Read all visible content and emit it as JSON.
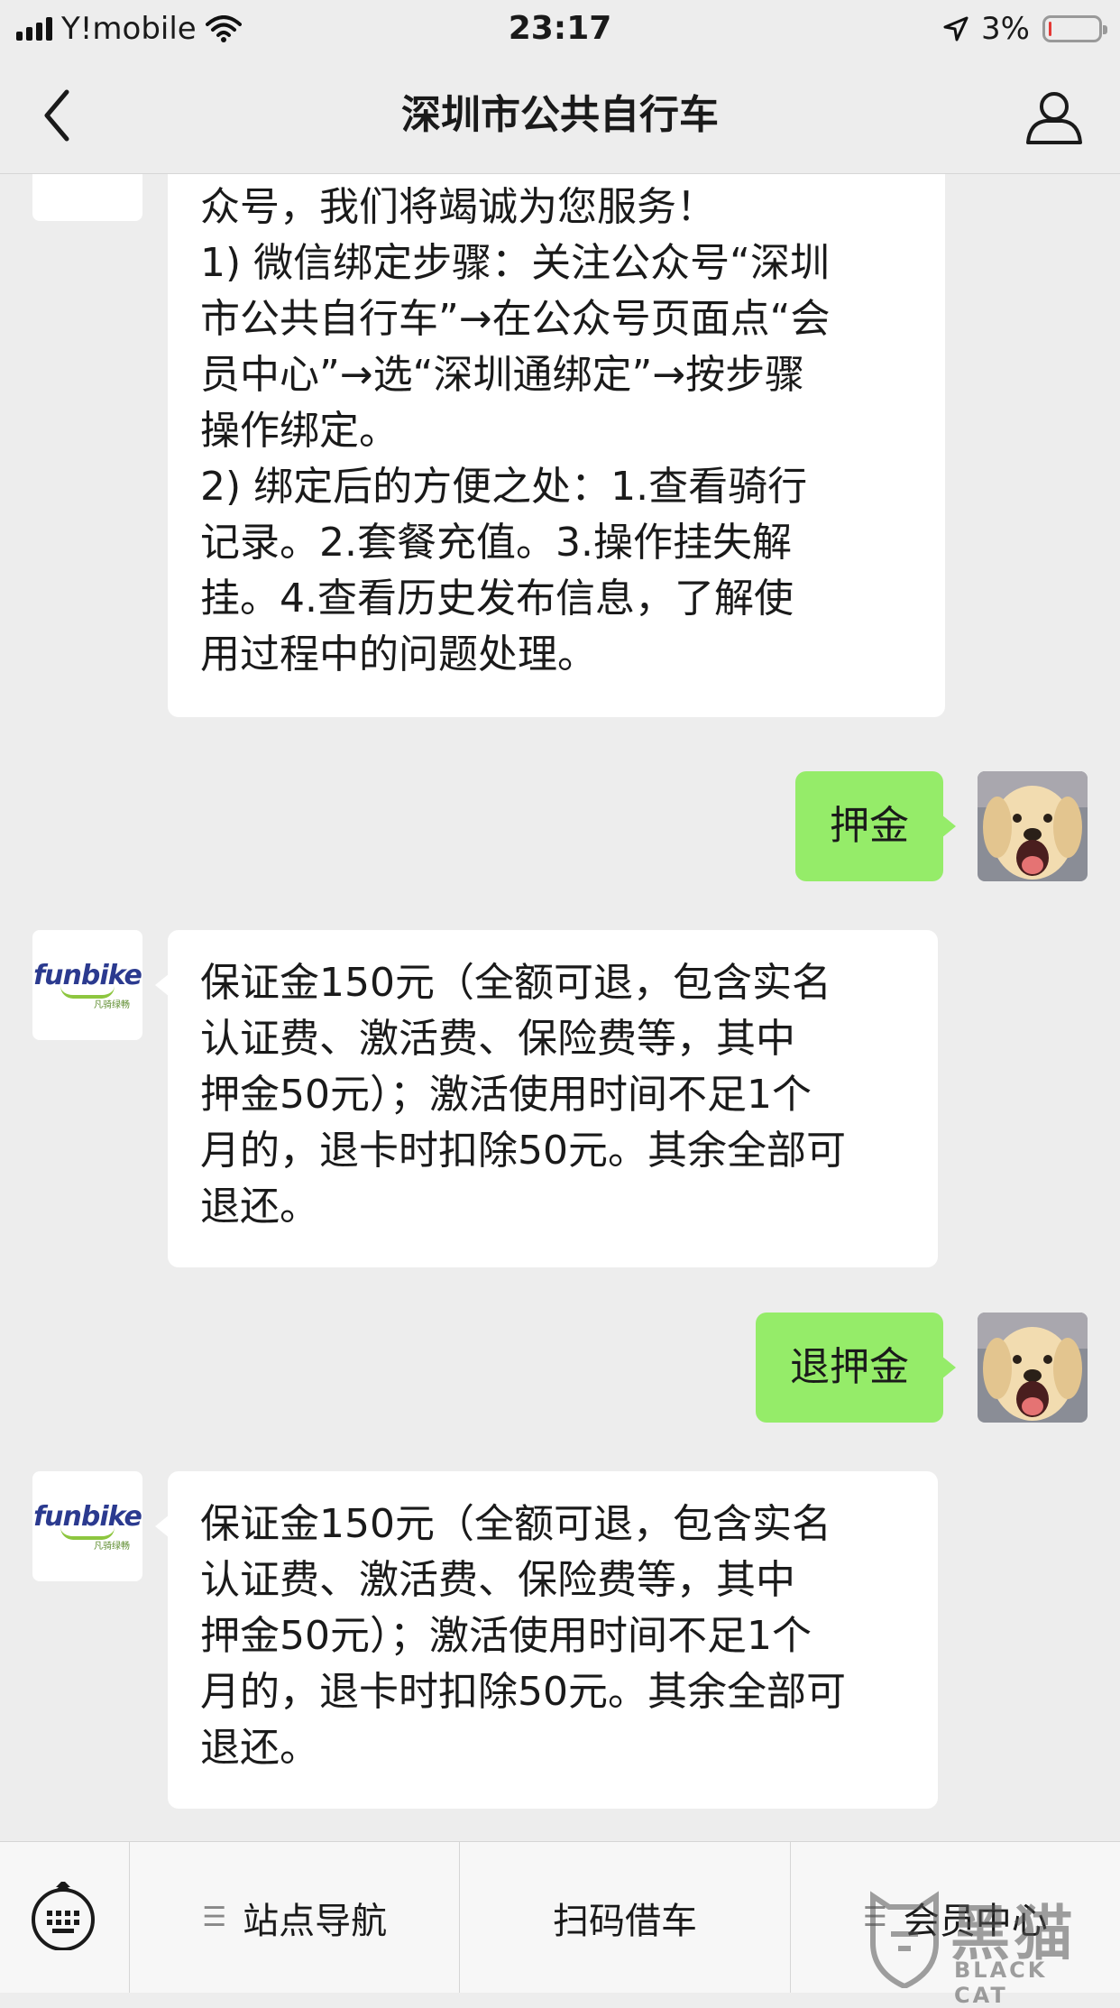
{
  "status_bar": {
    "carrier": "Y!mobile",
    "time": "23:17",
    "battery_percent": "3%",
    "battery_level": 0.03
  },
  "nav": {
    "title": "深圳市公共自行车"
  },
  "messages": [
    {
      "side": "in",
      "text_lines": [
        "众号，我们将竭诚为您服务！",
        "1) 微信绑定步骤：关注公众号“深圳",
        "市公共自行车”→在公众号页面点“会",
        "员中心”→选“深圳通绑定”→按步骤",
        "操作绑定。",
        "2) 绑定后的方便之处：1.查看骑行",
        "记录。2.套餐充值。3.操作挂失解",
        "挂。4.查看历史发布信息，了解使",
        "用过程中的问题处理。"
      ]
    },
    {
      "side": "out",
      "text": "押金"
    },
    {
      "side": "in",
      "text_lines": [
        "保证金150元（全额可退，包含实名",
        "认证费、激活费、保险费等，其中",
        "押金50元）；激活使用时间不足1个",
        "月的，退卡时扣除50元。其余全部可",
        "退还。"
      ]
    },
    {
      "side": "out",
      "text": "退押金"
    },
    {
      "side": "in",
      "text_lines": [
        "保证金150元（全额可退，包含实名",
        "认证费、激活费、保险费等，其中",
        "押金50元）；激活使用时间不足1个",
        "月的，退卡时扣除50元。其余全部可",
        "退还。"
      ]
    }
  ],
  "bot_avatar": {
    "logo_text": "funbike",
    "logo_sub": "凡骑绿畅"
  },
  "menu": {
    "items": [
      "站点导航",
      "扫码借车",
      "会员中心"
    ],
    "menu_glyph": "☰"
  },
  "watermark": {
    "cn": "黑猫",
    "en": "BLACK CAT"
  },
  "icons": {
    "back": "chevron-left-icon",
    "profile": "person-icon",
    "keyboard": "keyboard-icon"
  }
}
